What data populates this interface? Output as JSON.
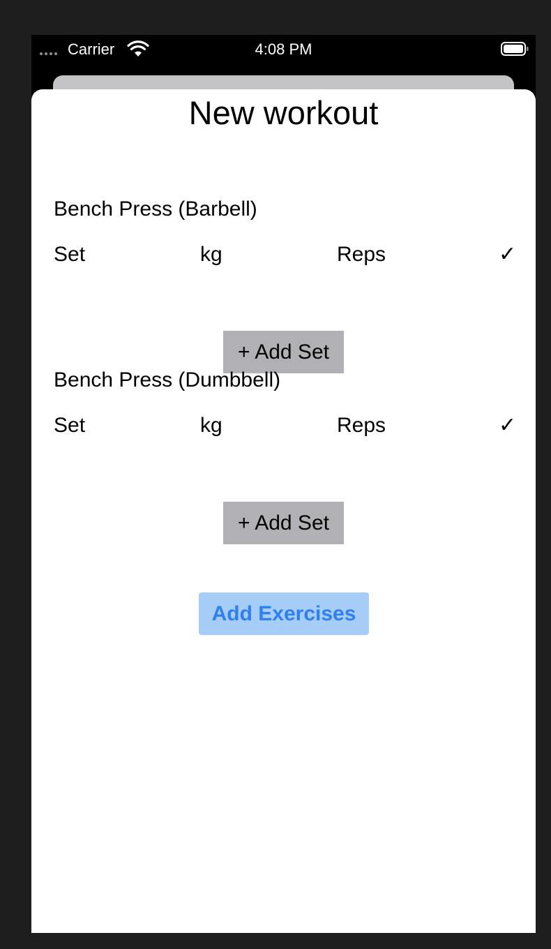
{
  "status_bar": {
    "carrier": "Carrier",
    "time": "4:08 PM",
    "signal_icon": "signal-dots-icon",
    "wifi_icon": "wifi-icon",
    "battery_icon": "battery-icon"
  },
  "sheet": {
    "title": "New workout"
  },
  "exercises": [
    {
      "name": "Bench Press (Barbell)",
      "columns": {
        "set": "Set",
        "kg": "kg",
        "reps": "Reps",
        "done": "✓"
      },
      "add_set_label": "+ Add Set"
    },
    {
      "name": "Bench Press (Dumbbell)",
      "columns": {
        "set": "Set",
        "kg": "kg",
        "reps": "Reps",
        "done": "✓"
      },
      "add_set_label": "+ Add Set"
    }
  ],
  "add_exercises_label": "Add Exercises",
  "colors": {
    "background": "#1e1e1e",
    "sheet": "#ffffff",
    "add_set_button": "#b1b1b5",
    "add_exercises_button": "#a6cdf8",
    "accent_text": "#2f7ff0"
  }
}
